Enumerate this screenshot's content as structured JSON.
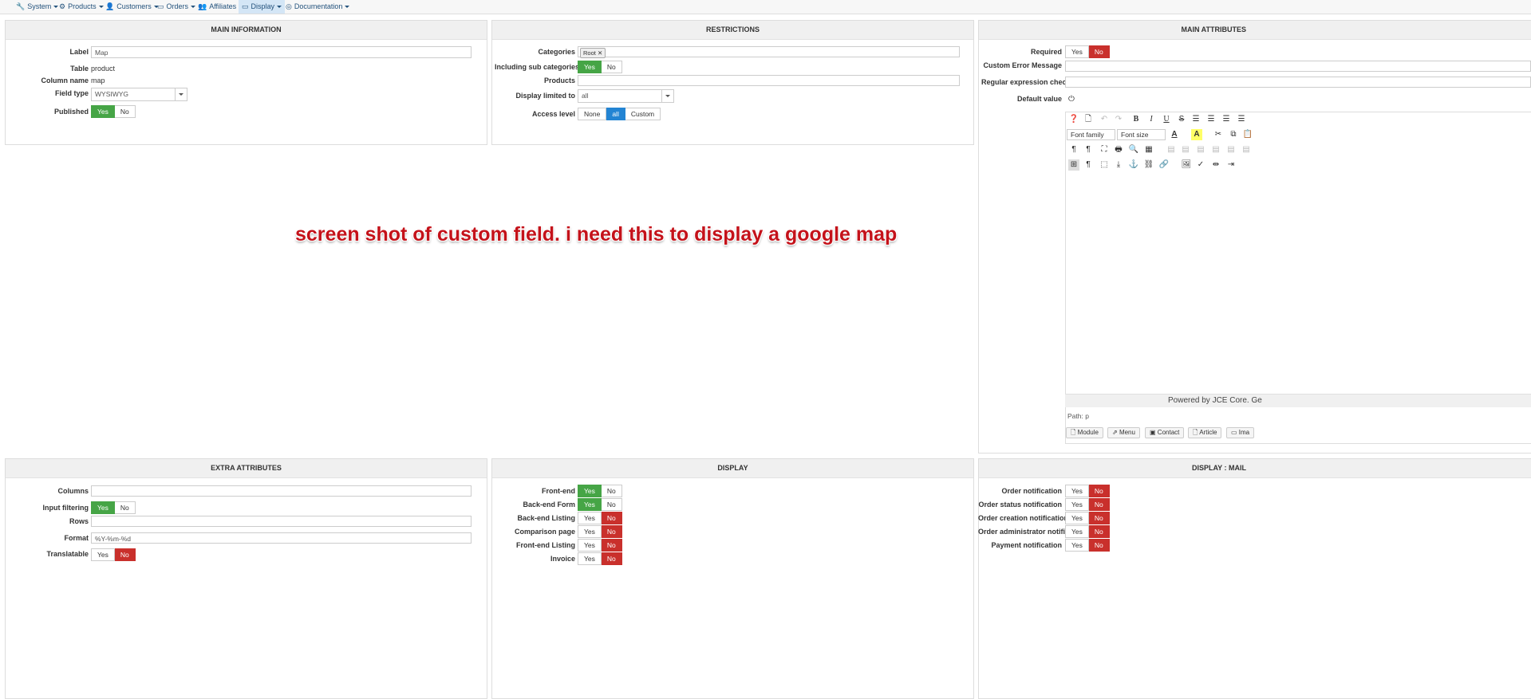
{
  "menu": [
    {
      "label": "System",
      "icon": "wrench-icon",
      "glyph": "🔧"
    },
    {
      "label": "Products",
      "icon": "cubes-icon",
      "glyph": "⚙"
    },
    {
      "label": "Customers",
      "icon": "user-icon",
      "glyph": "👤"
    },
    {
      "label": "Orders",
      "icon": "credit-card-icon",
      "glyph": "▭"
    },
    {
      "label": "Affiliates",
      "icon": "users-icon",
      "glyph": "👥"
    },
    {
      "label": "Display",
      "icon": "monitor-icon",
      "glyph": "▭"
    },
    {
      "label": "Documentation",
      "icon": "life-ring-icon",
      "glyph": "◎"
    }
  ],
  "main_info": {
    "title": "MAIN INFORMATION",
    "label_label": "Label",
    "label_value": "Map",
    "table_label": "Table",
    "table_value": "product",
    "column_label": "Column name",
    "column_value": "map",
    "fieldtype_label": "Field type",
    "fieldtype_value": "WYSIWYG",
    "published_label": "Published",
    "yes": "Yes",
    "no": "No"
  },
  "restrictions": {
    "title": "RESTRICTIONS",
    "categories_label": "Categories",
    "category_chip": "Root",
    "subcat_label": "Including sub categories",
    "yes": "Yes",
    "no": "No",
    "products_label": "Products",
    "display_limited_label": "Display limited to",
    "display_limited_value": "all",
    "access_label": "Access level",
    "access_none": "None",
    "access_all": "all",
    "access_custom": "Custom"
  },
  "main_attrs": {
    "title": "MAIN ATTRIBUTES",
    "required_label": "Required",
    "yes": "Yes",
    "no": "No",
    "error_label": "Custom Error Message",
    "regex_label": "Regular expression check",
    "default_label": "Default value"
  },
  "editor": {
    "font_family": "Font family",
    "font_size": "Font size",
    "powered": "Powered by JCE Core. Ge",
    "path": "Path: p",
    "tabs": [
      "Module",
      "Menu",
      "Contact",
      "Article",
      "Ima"
    ]
  },
  "overlay_text": "screen shot of custom field. i need this to display a google map",
  "extra_attrs": {
    "title": "EXTRA ATTRIBUTES",
    "columns_label": "Columns",
    "filter_label": "Input filtering",
    "rows_label": "Rows",
    "format_label": "Format",
    "format_value": "%Y-%m-%d",
    "translatable_label": "Translatable",
    "yes": "Yes",
    "no": "No"
  },
  "display": {
    "title": "DISPLAY",
    "rows": [
      {
        "label": "Front-end",
        "state": "yes"
      },
      {
        "label": "Back-end Form",
        "state": "yes"
      },
      {
        "label": "Back-end Listing",
        "state": "no"
      },
      {
        "label": "Comparison page",
        "state": "no"
      },
      {
        "label": "Front-end Listing",
        "state": "no"
      },
      {
        "label": "Invoice",
        "state": "no"
      }
    ],
    "yes": "Yes",
    "no": "No"
  },
  "display_mail": {
    "title": "DISPLAY : MAIL",
    "rows": [
      {
        "label": "Order notification",
        "state": "no"
      },
      {
        "label": "Order status notification",
        "state": "no"
      },
      {
        "label": "Order creation notification",
        "state": "no"
      },
      {
        "label": "Order administrator notific...",
        "state": "no"
      },
      {
        "label": "Payment notification",
        "state": "no"
      }
    ],
    "yes": "Yes",
    "no": "No"
  }
}
